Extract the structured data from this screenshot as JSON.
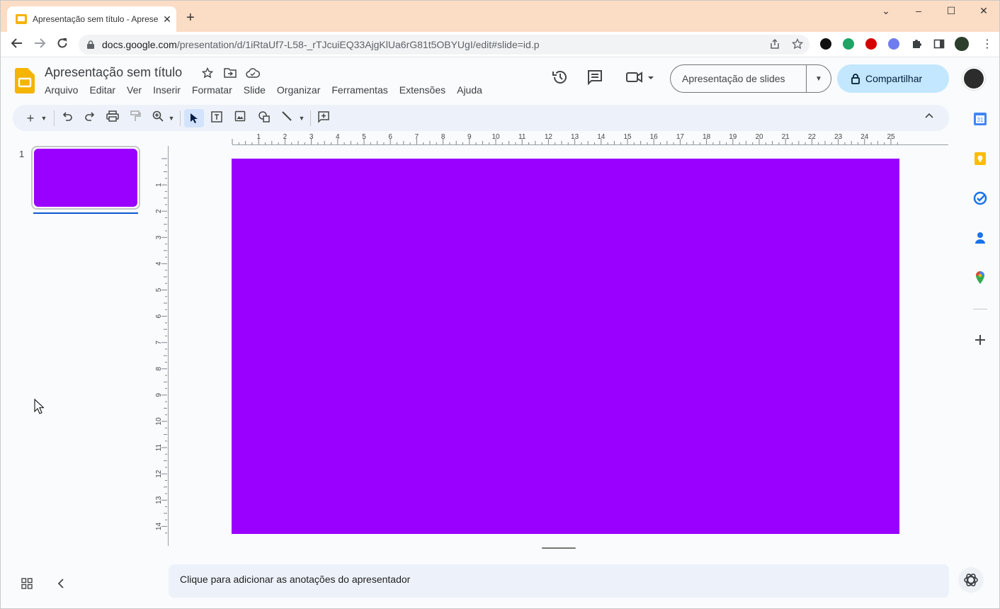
{
  "browser": {
    "tab_title": "Apresentação sem título - Apresentações Google",
    "url_host": "docs.google.com",
    "url_path": "/presentation/d/1iRtaUf7-L58-_rTJcuiEQ33AjgKlUa6rG81t5OBYUgI/edit#slide=id.p",
    "new_tab_glyph": "+",
    "close_glyph": "✕",
    "window_controls": [
      "⌄",
      "–",
      "☐",
      "✕"
    ]
  },
  "app": {
    "doc_title": "Apresentação sem título",
    "menu": [
      "Arquivo",
      "Editar",
      "Ver",
      "Inserir",
      "Formatar",
      "Slide",
      "Organizar",
      "Ferramentas",
      "Extensões",
      "Ajuda"
    ],
    "present_label": "Apresentação de slides",
    "share_label": "Compartilhar"
  },
  "ruler": {
    "horizontal_ticks": [
      "1",
      "2",
      "3",
      "4",
      "5",
      "6",
      "7",
      "8",
      "9",
      "10",
      "11",
      "12",
      "13",
      "14",
      "15",
      "16",
      "17",
      "18",
      "19",
      "20",
      "21",
      "22",
      "23",
      "24",
      "25"
    ],
    "vertical_ticks": [
      "1",
      "2",
      "3",
      "4",
      "5",
      "6",
      "7",
      "8",
      "9",
      "10",
      "11",
      "12",
      "13",
      "14"
    ]
  },
  "filmstrip": {
    "slide_number": "1"
  },
  "slide": {
    "background_color": "#9900ff"
  },
  "notes": {
    "placeholder": "Clique para adicionar as anotações do apresentador"
  },
  "colors": {
    "tabstrip": "#fbdcc5",
    "accent_blue": "#0b57d0",
    "share_bg": "#c2e7ff",
    "slide_purple": "#9900ff"
  }
}
